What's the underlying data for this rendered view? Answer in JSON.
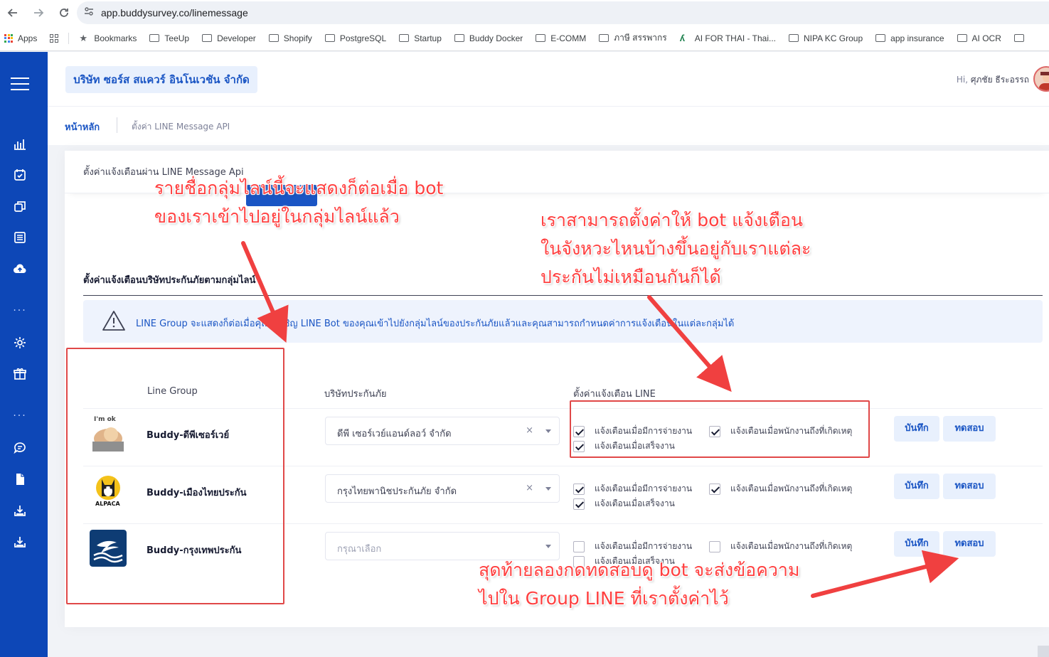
{
  "browser": {
    "url": "app.buddysurvey.co/linemessage",
    "bookmarks": [
      "Apps",
      "Bookmarks",
      "TeeUp",
      "Developer",
      "Shopify",
      "PostgreSQL",
      "Startup",
      "Buddy Docker",
      "E-COMM",
      "ภาษี สรรพากร",
      "AI FOR THAI - Thai...",
      "NIPA KC Group",
      "app insurance",
      "AI OCR"
    ]
  },
  "header": {
    "company": "บริษัท ซอร์ส สแควร์ อินโนเวชัน จำกัด",
    "greeting": "Hi,",
    "user_name": "ศุภชัย ธีระอรรถ"
  },
  "breadcrumb": {
    "home": "หน้าหลัก",
    "current": "ตั้งค่า LINE Message API"
  },
  "page": {
    "card_title": "ตั้งค่าแจ้งเตือนผ่าน LINE Message Api",
    "section_title": "ตั้งค่าแจ้งเตือนบริษัทประกันภัยตามกลุ่มไลน์",
    "alert_text": "LINE Group จะแสดงก็ต่อเมื่อคุณได้เชิญ LINE Bot ของคุณเข้าไปยังกลุ่มไลน์ของประกันภัยแล้วและคุณสามารถกำหนดค่าการแจ้งเตือนในแต่ละกลุ่มได้",
    "columns": {
      "group": "Line Group",
      "insurer": "บริษัทประกันภัย",
      "notify": "ตั้งค่าแจ้งเตือน LINE"
    },
    "checkbox_labels": {
      "assign": "แจ้งเตือนเมื่อมีการจ่ายงาน",
      "arrive": "แจ้งเตือนเมื่อพนักงานถึงที่เกิดเหตุ",
      "done": "แจ้งเตือนเมื่อเสร็จงาน"
    },
    "save_label": "บันทึก",
    "test_label": "ทดสอบ",
    "clear_symbol": "×",
    "rows": [
      {
        "name": "Buddy-ดีพีเซอร์เวย์",
        "insurer": "ดีพี เซอร์เวย์แอนด์ลอว์ จำกัด",
        "assign": true,
        "arrive": true,
        "done": true,
        "logo_text": "I'm ok"
      },
      {
        "name": "Buddy-เมืองไทยประกัน",
        "insurer": "กรุงไทยพานิชประกันภัย จำกัด",
        "assign": true,
        "arrive": true,
        "done": true,
        "logo_text": "ALPACA"
      },
      {
        "name": "Buddy-กรุงเทพประกัน",
        "insurer": "",
        "placeholder": "กรุณาเลือก",
        "assign": false,
        "arrive": false,
        "done": false,
        "logo_text": ""
      }
    ]
  },
  "annotations": {
    "note_group_line1": "รายชื่อกลุ่มไลน์นี้จะแสดงก็ต่อเมื่อ bot",
    "note_group_line2": "ของเราเข้าไปอยู่ในกลุ่มไลน์แล้ว",
    "note_config_line1": "เราสามารถตั้งค่าให้ bot แจ้งเตือน",
    "note_config_line2": "ในจังหวะไหนบ้างขึ้นอยู่กับเราแต่ละ",
    "note_config_line3": "ประกันไม่เหมือนกันก็ได้",
    "note_test_line1": "สุดท้ายลองกดทดสอบดู bot จะส่งข้อความ",
    "note_test_line2": "ไปใน Group LINE ที่เราตั้งค่าไว้",
    "color": "#ff4040"
  },
  "colors": {
    "sidebar": "#0d47b7",
    "accent": "#1a55c4",
    "button_bg": "#e8f0fd",
    "annotation_box": "#e04848"
  }
}
